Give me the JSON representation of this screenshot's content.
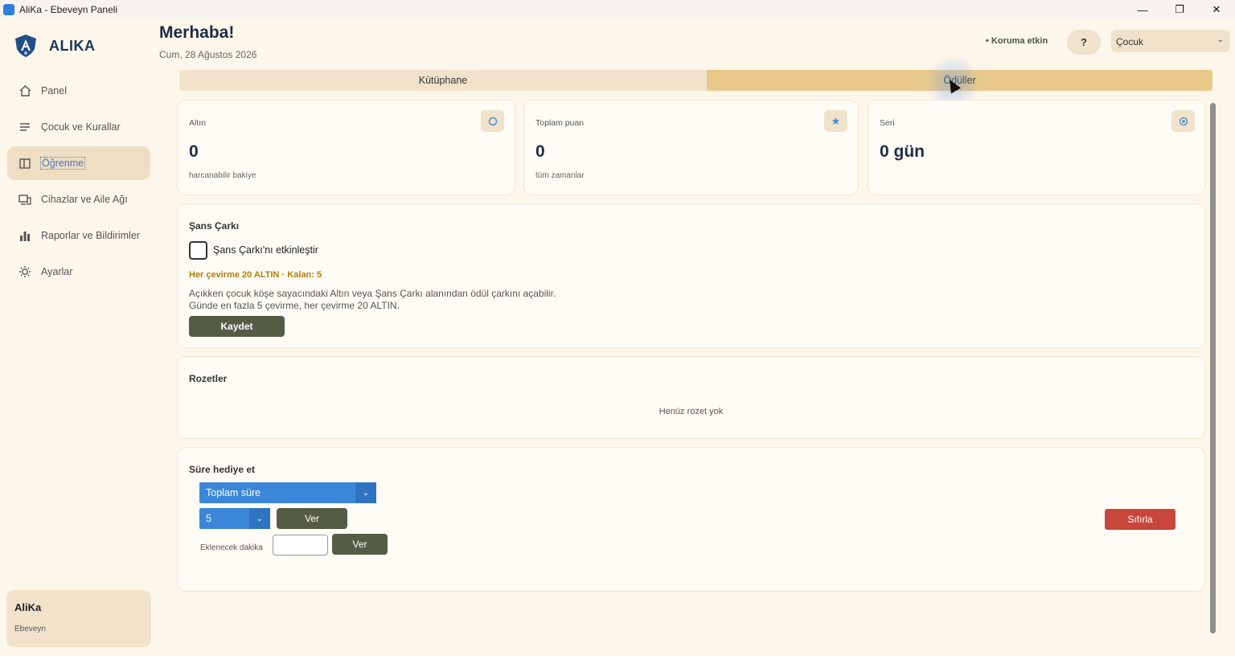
{
  "window": {
    "title": "AliKa - Ebeveyn Paneli",
    "controls": {
      "minimize": "—",
      "maximize": "❐",
      "close": "✕"
    }
  },
  "sidebar": {
    "brand": "ALIKA",
    "items": [
      {
        "label": "Panel",
        "icon": "home-icon"
      },
      {
        "label": "Çocuk ve Kurallar",
        "icon": "list-icon"
      },
      {
        "label": "Öğrenme",
        "icon": "book-icon",
        "active": true
      },
      {
        "label": "Cihazlar ve Aile Ağı",
        "icon": "devices-icon"
      },
      {
        "label": "Raporlar ve Bildirimler",
        "icon": "bar-chart-icon"
      },
      {
        "label": "Ayarlar",
        "icon": "gear-icon"
      }
    ],
    "user": {
      "name": "AliKa",
      "role": "Ebeveyn"
    }
  },
  "header": {
    "greeting": "Merhaba!",
    "date": "Cum, 28 Ağustos 2026",
    "status": "• Koruma etkin",
    "help": "?",
    "child_select": "Çocuk"
  },
  "tabs": [
    {
      "label": "Kütüphane",
      "active": false
    },
    {
      "label": "Ödüller",
      "active": true
    }
  ],
  "stats": [
    {
      "label": "Altın",
      "value": "0",
      "sub": "harcanabilir bakiye",
      "icon": "coin-icon"
    },
    {
      "label": "Toplam puan",
      "value": "0",
      "sub": "tüm zamanlar",
      "icon": "star-icon"
    },
    {
      "label": "Seri",
      "value": "0 gün",
      "sub": "",
      "icon": "flame-icon"
    }
  ],
  "wheel": {
    "title": "Şans Çarkı",
    "checkbox_label": "Şans Çarkı'nı etkinleştir",
    "info": "Her çevirme 20 ALTIN · Kalan: 5",
    "desc_line1": "Açıkken çocuk köşe sayacındaki Altın veya Şans Çarkı alanından ödül çarkını açabilir.",
    "desc_line2": "Günde en fazla 5 çevirme, her çevirme 20 ALTIN.",
    "save": "Kaydet"
  },
  "badges": {
    "title": "Rozetler",
    "empty": "Henüz rozet yok"
  },
  "gift": {
    "title": "Süre hediye et",
    "type_select": "Toplam süre",
    "amount_select": "5",
    "give": "Ver",
    "minutes_label": "Eklenecek dakika",
    "minutes_value": "",
    "give2": "Ver",
    "reset": "Sıfırla"
  },
  "colors": {
    "accent": "#3b86d8",
    "tab_active": "#e9c98b",
    "danger": "#c9463c",
    "dark_button": "#555c46",
    "warn_text": "#b07d0a"
  }
}
